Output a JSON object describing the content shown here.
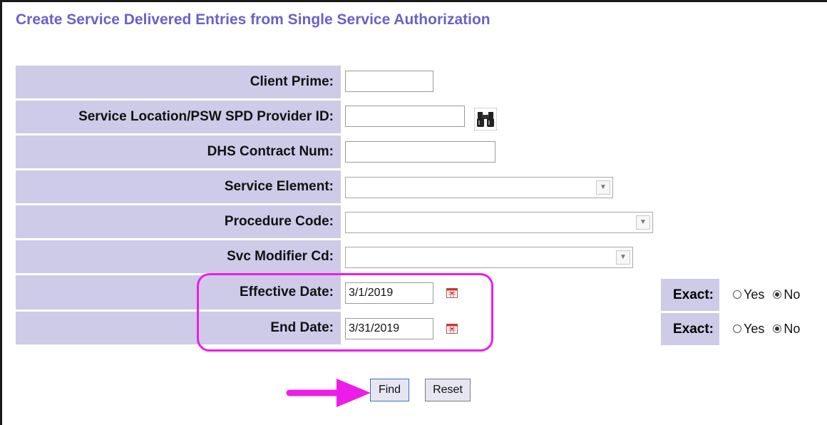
{
  "title": "Create Service Delivered Entries from Single Service Authorization",
  "fields": {
    "client_prime": {
      "label": "Client Prime:",
      "value": ""
    },
    "service_location": {
      "label": "Service Location/PSW SPD Provider ID:",
      "value": ""
    },
    "dhs_contract": {
      "label": "DHS Contract Num:",
      "value": ""
    },
    "service_element": {
      "label": "Service Element:",
      "value": ""
    },
    "procedure_code": {
      "label": "Procedure Code:",
      "value": ""
    },
    "svc_modifier": {
      "label": "Svc Modifier Cd:",
      "value": ""
    },
    "effective_date": {
      "label": "Effective Date:",
      "value": "3/1/2019",
      "exact_label": "Exact:",
      "yes": "Yes",
      "no": "No",
      "exact_selected": "No"
    },
    "end_date": {
      "label": "End Date:",
      "value": "3/31/2019",
      "exact_label": "Exact:",
      "yes": "Yes",
      "no": "No",
      "exact_selected": "No"
    }
  },
  "buttons": {
    "find": "Find",
    "reset": "Reset"
  },
  "icons": {
    "lookup": "binoculars-icon",
    "calendar": "calendar-icon",
    "annotation_arrow": "arrow-icon"
  },
  "colors": {
    "title": "#6a61c8",
    "label_bg": "#cdcbe8",
    "highlight": "#ee1ce8"
  }
}
